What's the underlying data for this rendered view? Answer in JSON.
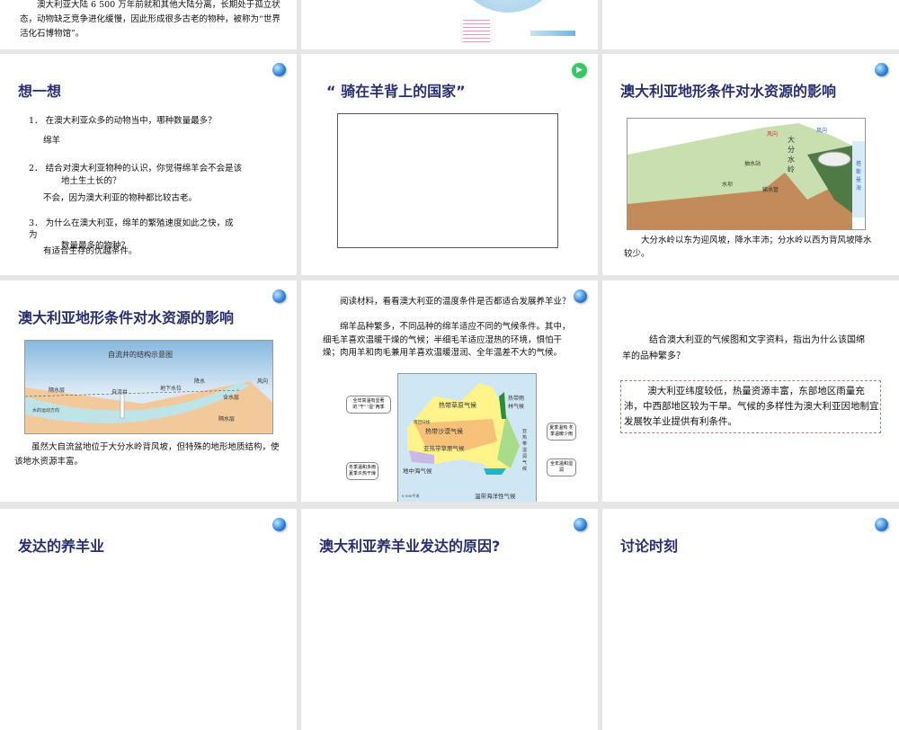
{
  "slides": {
    "top_left": {
      "text": "澳大利亚大陆 6 500 万年前就和其他大陆分离，长期处于孤立状态，动物缺乏竞争进化缓慢，因此形成很多古老的物种，被称为“世界活化石博物馆”。"
    },
    "think": {
      "title": "想一想",
      "q1": "1． 在澳大利亚众多的动物当中，哪种数量最多？",
      "a1": "绵羊",
      "q2a": "2． 结合对澳大利亚物种的认识，你觉得绵羊会不会是该",
      "q2b": "地土生土长的？",
      "a2": "不会，因为澳大利亚的物种都比较古老。",
      "q3a": "3． 为什么在澳大利亚，绵羊的繁殖速度如此之快，成",
      "q3b": "为",
      "q3c": "数量最多的物种？",
      "a3": "有适合生存的优越条件。"
    },
    "sheep_country": {
      "title": "“ 骑在羊背上的国家”",
      "media_icon": "video-icon"
    },
    "terrain1": {
      "title": "澳大利亚地形条件对水资源的影响",
      "labels": {
        "wind": "风向",
        "wind2": "风向",
        "range": "大分水岭",
        "pump": "抽水站",
        "dam": "水坝",
        "pipe": "输水管",
        "sea": "塔斯曼海"
      },
      "caption": "大分水岭以东为迎风坡，降水丰沛；分水岭以西为背风坡降水较少。"
    },
    "terrain2": {
      "title": "澳大利亚地形条件对水资源的影响",
      "fig_title": "自流井的结构示意图",
      "labels": {
        "rain": "降水",
        "wind": "风向",
        "aquiclude": "隔水层",
        "well": "自流井",
        "water_table": "地下水位",
        "aquifer": "含水层",
        "aquiclude2": "隔水层",
        "flow": "水的运动方向"
      },
      "caption": "虽然大自流盆地位于大分水岭背风坡，但特殊的地形地质结构，使该地水资源丰富。"
    },
    "climate": {
      "text1": "阅读材料，看看澳大利亚的温度条件是否都适合发展养羊业？",
      "text2": "绵羊品种繁多，不同品种的绵羊适应不同的气候条件。其中，细毛羊喜欢温暖干燥的气候；半细毛羊适应湿热的环境，惧怕干燥；肉用羊和肉毛兼用羊喜欢温暖湿润、全年温差不大的气候。",
      "map_labels": {
        "savanna": "热带草原气候",
        "rainforest": "热带雨林气候",
        "desert": "热带沙漠气候",
        "subtropic_savanna": "亚热带草原气候",
        "humid": "亚热带湿润气候",
        "mediterranean": "地中海气候",
        "oceanic": "温带海洋性气候",
        "tropic_line": "南回归线",
        "scale": "0    500千米"
      },
      "callouts": [
        "全年高温有显著的“干”“湿”两季",
        "夏季温热 冬季温暖少雨",
        "冬季温和多雨 夏季炎热干燥",
        "全年温和湿润"
      ]
    },
    "question": {
      "text": "结合澳大利亚的气候图和文字资料，指出为什么该国绵羊的品种繁多？",
      "answer": "澳大利亚纬度较低，热量资源丰富，东部地区雨量充沛，中西部地区较为干旱。气候的多样性为澳大利亚因地制宜发展牧羊业提供有利条件。"
    },
    "bottom": [
      {
        "title": "发达的养羊业"
      },
      {
        "title": "澳大利亚养羊业发达的原因?"
      },
      {
        "title": "讨论时刻"
      }
    ]
  }
}
